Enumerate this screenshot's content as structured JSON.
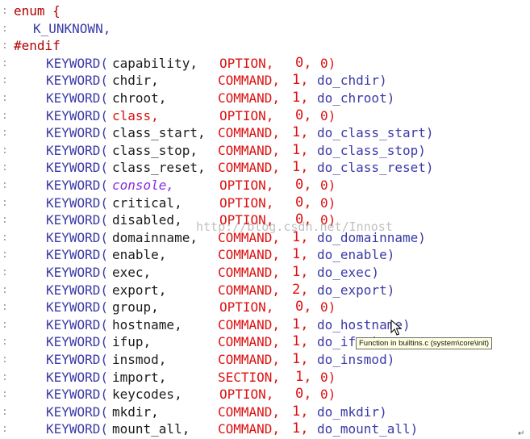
{
  "header": [
    {
      "kind": "enum",
      "text": "enum {"
    },
    {
      "kind": "member",
      "text": "K_UNKNOWN,"
    },
    {
      "kind": "endif",
      "text": "#endif"
    }
  ],
  "rows": [
    {
      "name": "capability,",
      "type": "OPTION,",
      "num": "0,",
      "arg": "0)"
    },
    {
      "name": "chdir,",
      "type": "COMMAND,",
      "num": "1,",
      "arg": "do_chdir)"
    },
    {
      "name": "chroot,",
      "type": "COMMAND,",
      "num": "1,",
      "arg": "do_chroot)"
    },
    {
      "name": "class,",
      "type": "OPTION,",
      "num": "0,",
      "arg": "0)"
    },
    {
      "name": "class_start,",
      "type": "COMMAND,",
      "num": "1,",
      "arg": "do_class_start)"
    },
    {
      "name": "class_stop,",
      "type": "COMMAND,",
      "num": "1,",
      "arg": "do_class_stop)"
    },
    {
      "name": "class_reset,",
      "type": "COMMAND,",
      "num": "1,",
      "arg": "do_class_reset)"
    },
    {
      "name": "console,",
      "type": "OPTION,",
      "num": "0,",
      "arg": "0)"
    },
    {
      "name": "critical,",
      "type": "OPTION,",
      "num": "0,",
      "arg": "0)"
    },
    {
      "name": "disabled,",
      "type": "OPTION,",
      "num": "0,",
      "arg": "0)"
    },
    {
      "name": "domainname,",
      "type": "COMMAND,",
      "num": "1,",
      "arg": "do_domainname)"
    },
    {
      "name": "enable,",
      "type": "COMMAND,",
      "num": "1,",
      "arg": "do_enable)"
    },
    {
      "name": "exec,",
      "type": "COMMAND,",
      "num": "1,",
      "arg": "do_exec)"
    },
    {
      "name": "export,",
      "type": "COMMAND,",
      "num": "2,",
      "arg": "do_export)"
    },
    {
      "name": "group,",
      "type": "OPTION,",
      "num": "0,",
      "arg": "0)"
    },
    {
      "name": "hostname,",
      "type": "COMMAND,",
      "num": "1,",
      "arg": "do_hostname)"
    },
    {
      "name": "ifup,",
      "type": "COMMAND,",
      "num": "1,",
      "arg": "do_ifup)"
    },
    {
      "name": "insmod,",
      "type": "COMMAND,",
      "num": "1,",
      "arg": "do_insmod)"
    },
    {
      "name": "import,",
      "type": "SECTION,",
      "num": "1,",
      "arg": "0)"
    },
    {
      "name": "keycodes,",
      "type": "OPTION,",
      "num": "0,",
      "arg": "0)"
    },
    {
      "name": "mkdir,",
      "type": "COMMAND,",
      "num": "1,",
      "arg": "do_mkdir)"
    },
    {
      "name": "mount_all,",
      "type": "COMMAND,",
      "num": "1,",
      "arg": "do_mount_all)"
    }
  ],
  "keyword_prefix": "KEYWORD(",
  "watermark": "http://blog.csdn.net/Innost",
  "tooltip": "Function in builtins.c (system\\core\\init)",
  "colors": {
    "keyword": "#3a3aa8",
    "red": "#dd1111",
    "purple": "#8a2be2",
    "preprocessor": "#b00000"
  }
}
